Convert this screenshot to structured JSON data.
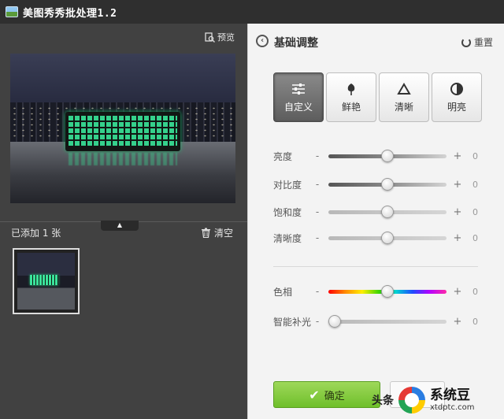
{
  "window": {
    "title": "美图秀秀批处理1.2"
  },
  "left": {
    "preview_label": "预览",
    "added_label": "已添加 1 张",
    "clear_label": "清空",
    "collapse_glyph": "▲"
  },
  "right": {
    "section_title": "基础调整",
    "reset_label": "重置",
    "modes": [
      {
        "label": "自定义",
        "icon": "sliders-icon",
        "active": true
      },
      {
        "label": "鲜艳",
        "icon": "flower-icon",
        "active": false
      },
      {
        "label": "清晰",
        "icon": "triangle-icon",
        "active": false
      },
      {
        "label": "明亮",
        "icon": "half-circle-icon",
        "active": false
      }
    ],
    "sliders": [
      {
        "label": "亮度",
        "value": "0",
        "level": 0.5
      },
      {
        "label": "对比度",
        "value": "0",
        "level": 0.5
      },
      {
        "label": "饱和度",
        "value": "0",
        "level": 0.5
      },
      {
        "label": "清晰度",
        "value": "0",
        "level": 0.5
      },
      {
        "label": "色相",
        "value": "0",
        "level": 0.5
      },
      {
        "label": "智能补光",
        "value": "0",
        "level": 0.0
      }
    ],
    "minus_sign": "-",
    "plus_sign": "+",
    "confirm_label": "确定"
  },
  "watermark": {
    "source_text": "头条",
    "brand": "系统豆",
    "url": "xtdptc.com"
  },
  "colors": {
    "accent_green": "#7ec63a",
    "panel_dark": "#414141",
    "panel_light": "#f3f3f3"
  }
}
